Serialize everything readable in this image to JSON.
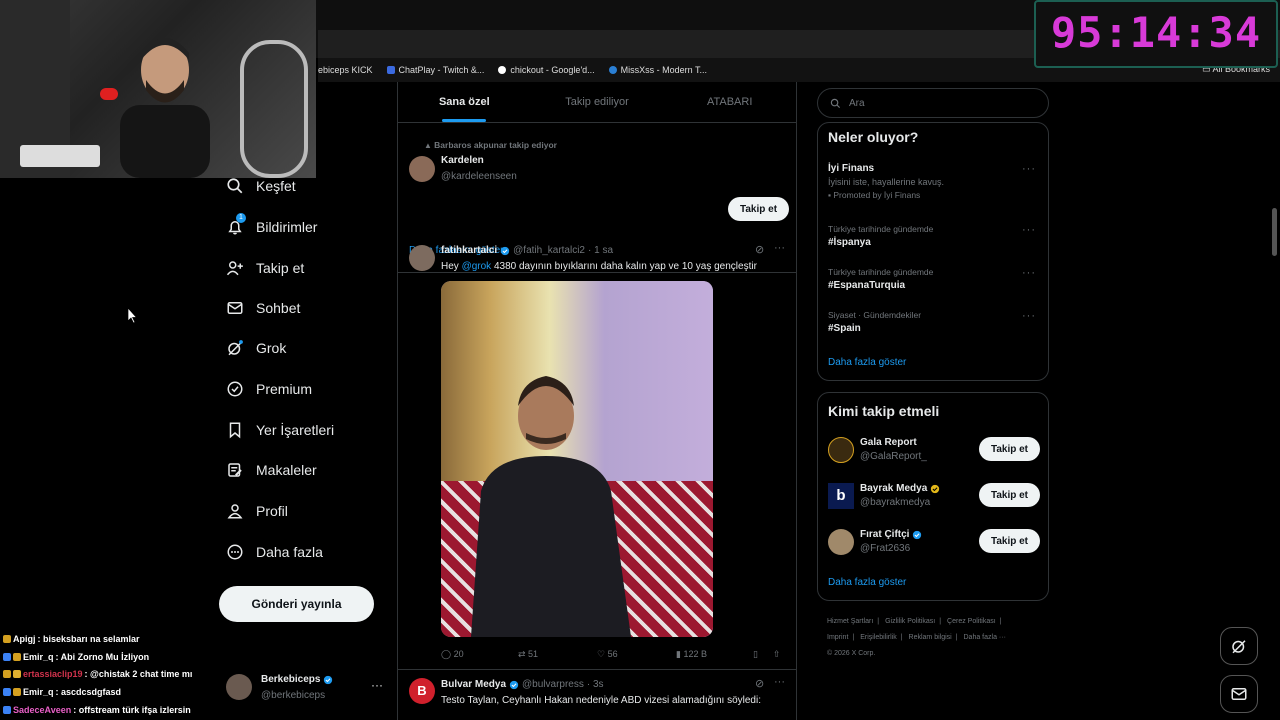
{
  "browser": {
    "bookmarks": [
      {
        "label": "ebiceps KICK"
      },
      {
        "label": "ChatPlay - Twitch &..."
      },
      {
        "label": "chickout - Google'd..."
      },
      {
        "label": "MissXss - Modern T..."
      }
    ],
    "all_bookmarks": "All Bookmarks"
  },
  "timer": "95:14:34",
  "nav": {
    "items": [
      {
        "label": "Keşfet",
        "icon": "search-icon"
      },
      {
        "label": "Bildirimler",
        "icon": "bell-icon"
      },
      {
        "label": "Takip et",
        "icon": "add-person-icon"
      },
      {
        "label": "Sohbet",
        "icon": "mail-icon"
      },
      {
        "label": "Grok",
        "icon": "grok-icon"
      },
      {
        "label": "Premium",
        "icon": "verified-icon"
      },
      {
        "label": "Yer İşaretleri",
        "icon": "bookmark-icon"
      },
      {
        "label": "Makaleler",
        "icon": "article-icon"
      },
      {
        "label": "Profil",
        "icon": "person-icon"
      },
      {
        "label": "Daha fazla",
        "icon": "more-circle-icon"
      }
    ],
    "notification_count": "1",
    "post_button": "Gönderi yayınla",
    "account": {
      "name": "Berkebiceps",
      "handle": "@berkebiceps"
    }
  },
  "feed": {
    "tabs": [
      {
        "label": "Sana özel"
      },
      {
        "label": "Takip ediliyor"
      },
      {
        "label": "ATABARI"
      }
    ],
    "suggestion": {
      "context": "Barbaros akpunar takip ediyor",
      "name": "Kardelen",
      "handle": "@kardeleenseen",
      "button": "Takip et"
    },
    "show_more": "Daha fazlasını göster",
    "tweets": [
      {
        "name": "fatihkartalci",
        "handle": "@fatih_kartalci2",
        "time": "· 1 sa",
        "mention": "@grok",
        "text_prefix": "Hey",
        "text": "4380 dayının bıyıklarını daha kalın yap ve 10 yaş gençleştir",
        "replies": "20",
        "retweets": "51",
        "likes": "56",
        "views": "122 B"
      },
      {
        "name": "Bulvar Medya",
        "handle": "@bulvarpress",
        "time": "· 3s",
        "text": "Testo Taylan, Ceyhanlı Hakan nedeniyle ABD vizesi alamadığını söyledi:"
      }
    ]
  },
  "sidebar": {
    "search_placeholder": "Ara",
    "trends_title": "Neler oluyor?",
    "promo": {
      "name": "İyi Finans",
      "subtitle": "İyisini iste, hayallerine kavuş.",
      "promoted": "Promoted by İyi Finans"
    },
    "trends": [
      {
        "category": "Türkiye tarihinde gündemde",
        "name": "#İspanya"
      },
      {
        "category": "Türkiye tarihinde gündemde",
        "name": "#EspanaTurquia"
      },
      {
        "category": "Siyaset · Gündemdekiler",
        "name": "#Spain"
      }
    ],
    "trends_more": "Daha fazla göster",
    "who_title": "Kimi takip etmeli",
    "who": [
      {
        "name": "Gala Report",
        "handle": "@GalaReport_",
        "button": "Takip et",
        "verified": false
      },
      {
        "name": "Bayrak Medya",
        "handle": "@bayrakmedya",
        "button": "Takip et",
        "verified": true
      },
      {
        "name": "Fırat Çiftçi",
        "handle": "@Frat2636",
        "button": "Takip et",
        "verified": true
      }
    ],
    "who_more": "Daha fazla göster",
    "footer": {
      "line1": [
        "Hizmet Şartları",
        "|",
        "Gizlilik Politikası",
        "|",
        "Çerez Politikası",
        "|"
      ],
      "line2": [
        "Imprint",
        "|",
        "Erişilebilirlik",
        "|",
        "Reklam bilgisi",
        "|",
        "Daha fazla ···"
      ],
      "line3": "© 2026 X Corp."
    }
  },
  "chat": [
    {
      "user": "Apigj",
      "msg": ": biseksbarı na selamlar",
      "color": "#ffffff"
    },
    {
      "user": "Emir_q",
      "msg": ": Abi Zorno Mu İzliyon",
      "color": "#ffffff"
    },
    {
      "user": "ertassiaclip19",
      "msg": ": @chistak 2 chat time mı",
      "color": "#d0324c"
    },
    {
      "user": "Emir_q",
      "msg": ": ascdcsdgfasd",
      "color": "#ffffff"
    },
    {
      "user": "SadeceAveen",
      "msg": ": offstream türk ifşa izlersin",
      "color": "#e85fc6"
    }
  ],
  "colors": {
    "accent": "#1d9bf0",
    "timer": "#d83ad8",
    "background": "#000000"
  }
}
